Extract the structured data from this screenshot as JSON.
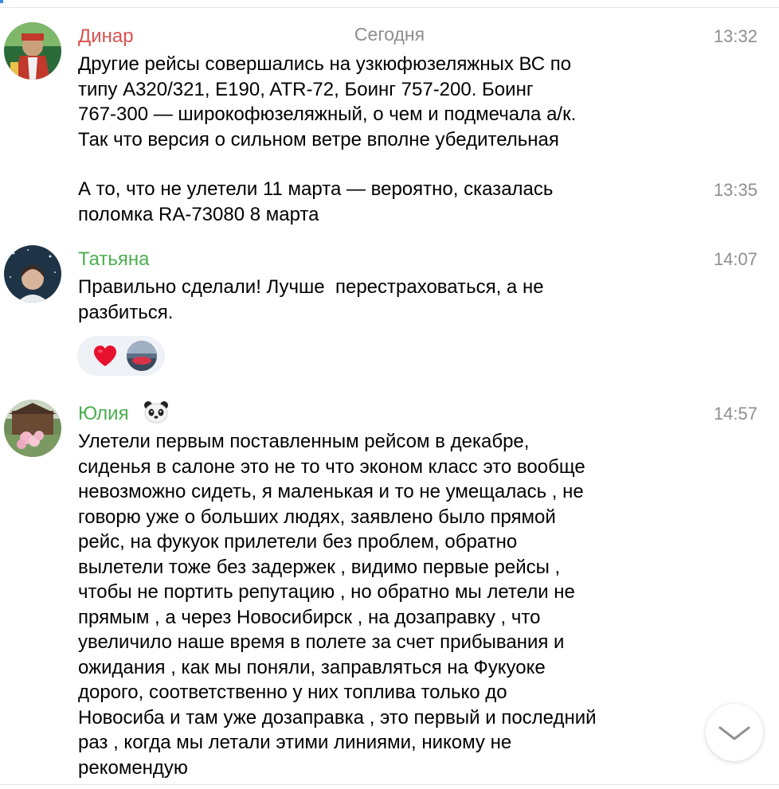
{
  "date_divider": "Сегодня",
  "colors": {
    "author_red": "#d9534f",
    "author_green": "#4caf50",
    "timestamp_gray": "#8e8e93",
    "reaction_bg": "#eef1f6",
    "heart": "#e8112d"
  },
  "messages": [
    {
      "author": "Динар",
      "time": "13:32",
      "text": "Другие рейсы совершались на узкюфюзеляжных ВС по\nтипу A320/321, E190, ATR-72, Боинг 757-200. Боинг\n767-300 — широкофюзеляжный, о чем и подмечала а/к.\nТак что версия о сильном ветре вполне убедительная"
    },
    {
      "author": "",
      "time": "13:35",
      "text": "А то, что не улетели 11 марта — вероятно, сказалась\nполомка RA-73080 8 марта"
    },
    {
      "author": "Татьяна",
      "time": "14:07",
      "text": "Правильно сделали! Лучше  перестраховаться, а не\nразбиться."
    },
    {
      "author": "Юлия",
      "author_icon": "panda-icon",
      "time": "14:57",
      "text": "Улетели первым поставленным рейсом в декабре,\nсиденья в салоне это не то что эконом класс это вообще\nневозможно сидеть, я маленькая и то не умещалась , не\nговорю уже о больших людях, заявлено было прямой\nрейс, на фукуок прилетели без проблем, обратно\nвылетели тоже без задержек , видимо первые рейсы ,\nчтобы не портить репутацию , но обратно мы летели не\nпрямым , а через Новосибирск , на дозаправку , что\nувеличило наше время в полете за счет прибывания и\nожидания , как мы поняли, заправляться на Фукуоке\nдорого, соответственно у них топлива только до\nНовосиба и там уже дозаправка , это первый и последний\nраз , когда мы летали этими линиями, никому не\nрекомендую"
    }
  ],
  "reactions": [
    {
      "icon": "heart-icon"
    },
    {
      "icon": "reactor-avatar"
    }
  ],
  "scroll_button_icon": "chevron-down-icon"
}
